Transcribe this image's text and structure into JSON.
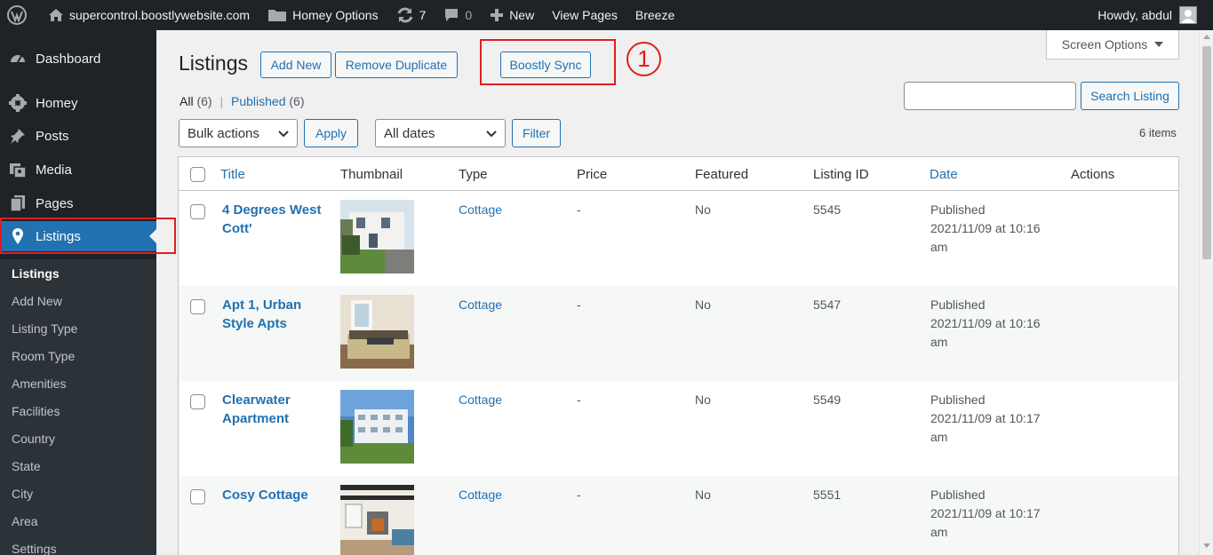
{
  "adminbar": {
    "site_name": "supercontrol.boostlywebsite.com",
    "homey_options": "Homey Options",
    "updates_count": "7",
    "comments_count": "0",
    "new_label": "New",
    "view_pages": "View Pages",
    "breeze": "Breeze",
    "howdy": "Howdy, abdul"
  },
  "sidebar": {
    "dashboard": "Dashboard",
    "homey": "Homey",
    "posts": "Posts",
    "media": "Media",
    "pages": "Pages",
    "listings": "Listings",
    "submenu": [
      "Listings",
      "Add New",
      "Listing Type",
      "Room Type",
      "Amenities",
      "Facilities",
      "Country",
      "State",
      "City",
      "Area",
      "Settings"
    ]
  },
  "header": {
    "title": "Listings",
    "add_new": "Add New",
    "remove_duplicate": "Remove Duplicate",
    "boostly_sync": "Boostly Sync",
    "callout": "1",
    "screen_options": "Screen Options"
  },
  "filters": {
    "all_label": "All",
    "all_count": "(6)",
    "separator": "|",
    "published_label": "Published",
    "published_count": "(6)",
    "search_value": "",
    "search_button": "Search Listing",
    "bulk_actions": "Bulk actions",
    "apply": "Apply",
    "all_dates": "All dates",
    "filter": "Filter",
    "items_count": "6 items"
  },
  "table": {
    "columns": [
      "Title",
      "Thumbnail",
      "Type",
      "Price",
      "Featured",
      "Listing ID",
      "Date",
      "Actions"
    ],
    "rows": [
      {
        "title": "4 Degrees West Cott'",
        "type": "Cottage",
        "price": "-",
        "featured": "No",
        "id": "5545",
        "status": "Published",
        "date": "2021/11/09 at 10:16",
        "ampm": "am"
      },
      {
        "title": "Apt 1, Urban Style Apts",
        "type": "Cottage",
        "price": "-",
        "featured": "No",
        "id": "5547",
        "status": "Published",
        "date": "2021/11/09 at 10:16",
        "ampm": "am"
      },
      {
        "title": "Clearwater Apartment",
        "type": "Cottage",
        "price": "-",
        "featured": "No",
        "id": "5549",
        "status": "Published",
        "date": "2021/11/09 at 10:17",
        "ampm": "am"
      },
      {
        "title": "Cosy Cottage",
        "type": "Cottage",
        "price": "-",
        "featured": "No",
        "id": "5551",
        "status": "Published",
        "date": "2021/11/09 at 10:17",
        "ampm": "am"
      }
    ]
  },
  "colors": {
    "admin_dark": "#1d2327",
    "accent_blue": "#2271b1",
    "highlight_red": "#e11d1d"
  }
}
